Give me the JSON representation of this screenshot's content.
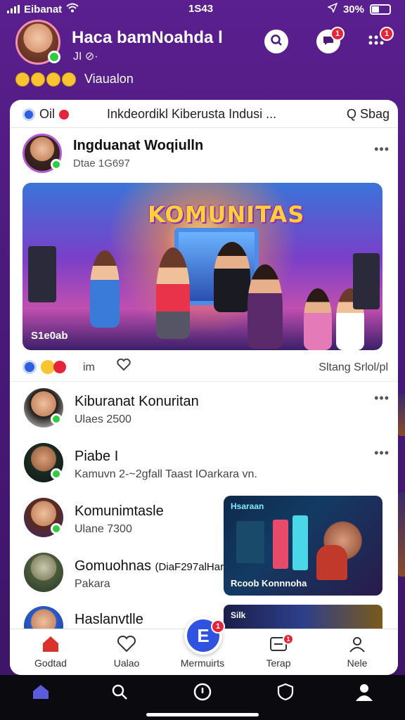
{
  "status_bar": {
    "carrier": "Eibanat",
    "time": "1S43",
    "battery": "30%",
    "icons": [
      "signal-icon",
      "wifi-icon",
      "location-icon",
      "battery-icon"
    ]
  },
  "profile": {
    "name": "Haca bamNoahda l",
    "subtitle": "JI ⊘·",
    "emoji_label": "Viaualon",
    "notification_count_1": "1",
    "notification_count_2": "1"
  },
  "tabbar": {
    "left_label": "Oil",
    "title": "Inkdeordikl Kiberusta Indusi ...",
    "search_label": "Q Sbag"
  },
  "post": {
    "author": "Ingduanat Woqiulln",
    "meta": "Dtae 1G697",
    "more": "•••",
    "banner_title": "KOMUNITAS",
    "banner_caption": "S1e0ab",
    "reaction_count": "im",
    "share_label": "Sltang Srlol/pl"
  },
  "feed": [
    {
      "name": "Kiburanat Konuritan",
      "meta": "Ulaes 2500",
      "more": "•••"
    },
    {
      "name": "Piabe I",
      "meta": "Kamuvn 2-~2gfall Taast IOarkara vn.",
      "more": "•••"
    },
    {
      "name": "Komunimtasle",
      "meta": "Ulane 7300"
    },
    {
      "name": "Gomuohnas",
      "meta": "Pakara",
      "extra": "(DiaF297alHar"
    },
    {
      "name": "Haslanvtlle",
      "meta": ""
    }
  ],
  "video": {
    "label": "Hsaraan",
    "caption": "Rcoob Konnnoha"
  },
  "video2": {
    "label": "Silk"
  },
  "inner_nav": {
    "items": [
      {
        "label": "Godtad",
        "icon": "home-icon"
      },
      {
        "label": "Ualao",
        "icon": "heart-icon"
      },
      {
        "label": "Mermuirts",
        "icon": "create-icon"
      },
      {
        "label": "Terap",
        "icon": "inbox-icon"
      },
      {
        "label": "Nele",
        "icon": "profile-icon"
      }
    ],
    "center_label": "E",
    "center_badge": "1",
    "inbox_badge": "1"
  },
  "colors": {
    "header_bg": "#5b1f8f",
    "accent_red": "#e5243b",
    "accent_blue": "#2f52e0",
    "online_green": "#2ecc40"
  }
}
